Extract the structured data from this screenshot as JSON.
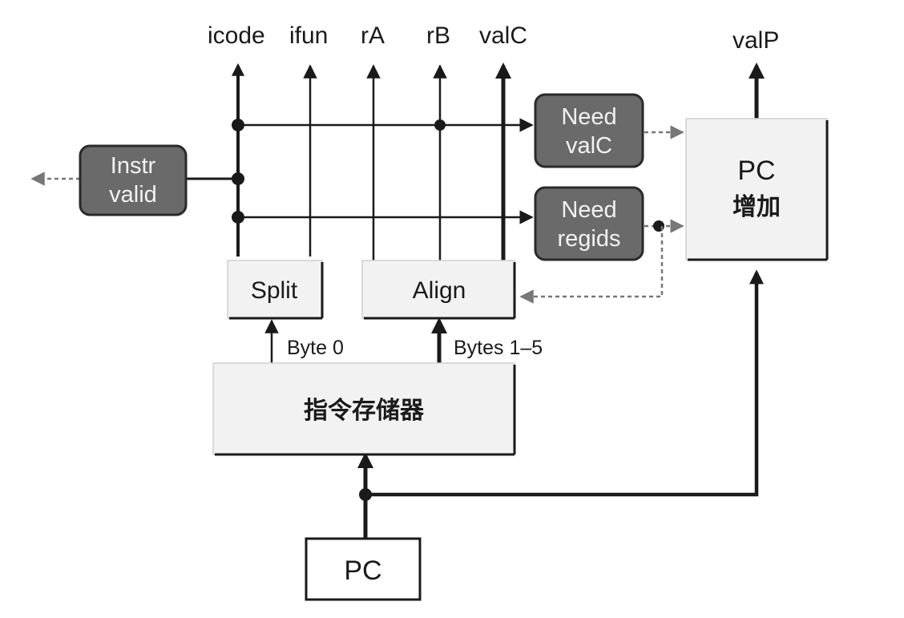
{
  "signals": {
    "icode": "icode",
    "ifun": "ifun",
    "rA": "rA",
    "rB": "rB",
    "valC": "valC",
    "valP": "valP"
  },
  "blocks": {
    "instr_valid": [
      "Instr",
      "valid"
    ],
    "need_valc": [
      "Need",
      "valC"
    ],
    "need_regids": [
      "Need",
      "regids"
    ],
    "pc_increment": [
      "PC",
      "增加"
    ],
    "split": "Split",
    "align": "Align",
    "instruction_memory": "指令存储器",
    "pc": "PC"
  },
  "edge_labels": {
    "byte0": "Byte 0",
    "bytes1_5": "Bytes 1–5"
  },
  "colors": {
    "line": "#1a1a1a",
    "dark_block": "#6a6a6a",
    "light_block": "#f2f2f2",
    "dashed": "#777777"
  }
}
